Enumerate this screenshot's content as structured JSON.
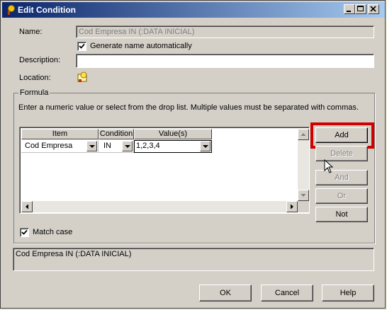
{
  "window": {
    "title": "Edit Condition"
  },
  "form": {
    "name_label": "Name:",
    "name_value": "Cod Empresa IN (:DATA INICIAL)",
    "generate_label": "Generate name automatically",
    "description_label": "Description:",
    "description_value": "",
    "location_label": "Location:"
  },
  "formula": {
    "group_label": "Formula",
    "instructions": "Enter a numeric value or select from the drop list. Multiple values must be separated with commas.",
    "columns": [
      "Item",
      "Condition",
      "Value(s)"
    ],
    "row": {
      "item": "Cod Empresa",
      "condition": "IN",
      "value": "1,2,3,4"
    },
    "buttons": {
      "add": "Add",
      "delete": "Delete",
      "and": "And",
      "or": "Or",
      "not": "Not"
    },
    "match_case_label": "Match case",
    "match_case_checked": true
  },
  "summary": {
    "text": "Cod Empresa IN (:DATA INICIAL)"
  },
  "footer": {
    "ok": "OK",
    "cancel": "Cancel",
    "help": "Help"
  },
  "colors": {
    "titlebar_start": "#0a246a",
    "titlebar_end": "#a6caf0",
    "highlight_border": "#d00000"
  },
  "icons": [
    "condition-icon",
    "minimize-icon",
    "maximize-icon",
    "close-icon",
    "location-folder-icon",
    "checkmark-icon",
    "mouse-pointer-icon"
  ]
}
